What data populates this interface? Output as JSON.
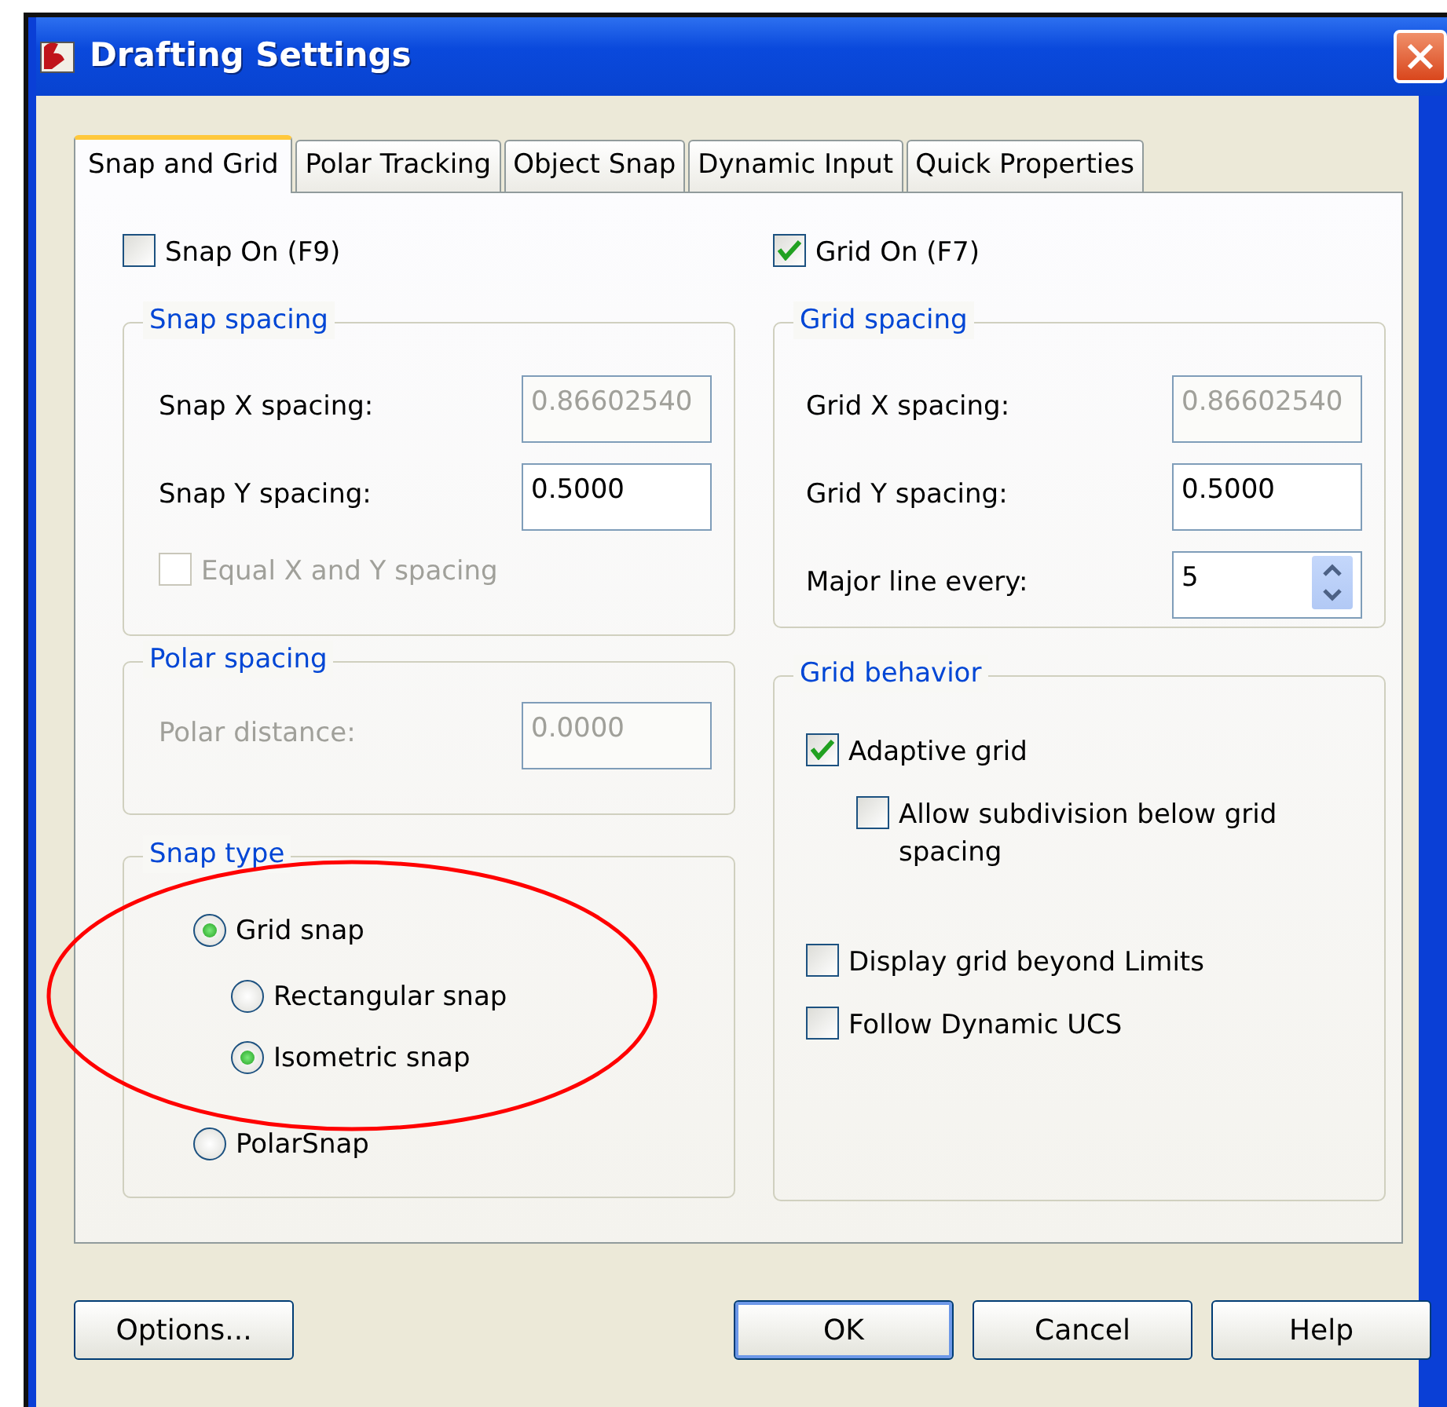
{
  "window": {
    "title": "Drafting Settings"
  },
  "tabs": [
    {
      "label": "Snap and Grid",
      "selected": true
    },
    {
      "label": "Polar Tracking",
      "selected": false
    },
    {
      "label": "Object Snap",
      "selected": false
    },
    {
      "label": "Dynamic Input",
      "selected": false
    },
    {
      "label": "Quick Properties",
      "selected": false
    }
  ],
  "snap_on": {
    "label": "Snap On (F9)",
    "checked": false
  },
  "grid_on": {
    "label": "Grid On (F7)",
    "checked": true
  },
  "snap_spacing": {
    "title": "Snap spacing",
    "fields": [
      {
        "label": "Snap X spacing:",
        "value": "0.86602540",
        "disabled": true,
        "kind": "text"
      },
      {
        "label": "Snap Y spacing:",
        "value": "0.5000",
        "disabled": false,
        "kind": "text"
      }
    ],
    "equal": {
      "label": "Equal X and Y spacing",
      "checked": false,
      "disabled": true
    }
  },
  "polar_spacing": {
    "title": "Polar spacing",
    "disabled": true,
    "fields": [
      {
        "label": "Polar distance:",
        "value": "0.0000",
        "disabled": true,
        "kind": "text"
      }
    ]
  },
  "snap_type": {
    "title": "Snap type",
    "options": [
      {
        "label": "Grid snap",
        "selected": true,
        "children": [
          {
            "label": "Rectangular snap",
            "selected": false
          },
          {
            "label": "Isometric snap",
            "selected": true
          }
        ]
      },
      {
        "label": "PolarSnap",
        "selected": false
      }
    ]
  },
  "grid_spacing": {
    "title": "Grid spacing",
    "fields": [
      {
        "label": "Grid X spacing:",
        "value": "0.86602540",
        "disabled": true,
        "kind": "text"
      },
      {
        "label": "Grid Y spacing:",
        "value": "0.5000",
        "disabled": false,
        "kind": "text"
      },
      {
        "label": "Major line every:",
        "value": "5",
        "disabled": false,
        "kind": "spinner"
      }
    ]
  },
  "grid_behavior": {
    "title": "Grid behavior",
    "options": [
      {
        "label": "Adaptive grid",
        "checked": true,
        "children": [
          {
            "label": "Allow subdivision below grid spacing",
            "checked": false
          }
        ]
      },
      {
        "label": "Display grid beyond Limits",
        "checked": false
      },
      {
        "label": "Follow Dynamic UCS",
        "checked": false
      }
    ]
  },
  "buttons": [
    {
      "label": "Options...",
      "default": false
    },
    {
      "label": "OK",
      "default": true
    },
    {
      "label": "Cancel",
      "default": false
    },
    {
      "label": "Help",
      "default": false
    }
  ],
  "annotation": {
    "kind": "ellipse",
    "color": "#ff0000"
  }
}
